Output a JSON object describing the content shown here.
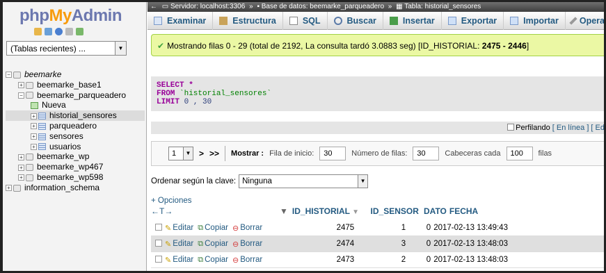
{
  "logo": {
    "php": "php",
    "my": "My",
    "admin": "Admin"
  },
  "recent": {
    "label": "(Tablas recientes) ..."
  },
  "tree": {
    "root": "beemarke",
    "items": [
      {
        "label": "beemarke_base1"
      },
      {
        "label": "beemarke_parqueadero"
      },
      {
        "label": "Nueva"
      },
      {
        "label": "historial_sensores"
      },
      {
        "label": "parqueadero"
      },
      {
        "label": "sensores"
      },
      {
        "label": "usuarios"
      },
      {
        "label": "beemarke_wp"
      },
      {
        "label": "beemarke_wp467"
      },
      {
        "label": "beemarke_wp598"
      },
      {
        "label": "information_schema"
      }
    ]
  },
  "breadcrumb": {
    "server": "Servidor: localhost:3306",
    "database": "Base de datos: beemarke_parqueadero",
    "table": "Tabla: historial_sensores",
    "sep": "»"
  },
  "tabs": [
    "Examinar",
    "Estructura",
    "SQL",
    "Buscar",
    "Insertar",
    "Exportar",
    "Importar",
    "Operac"
  ],
  "message": {
    "text": "Mostrando filas 0 - 29 (total de 2192, La consulta tardó 3.0883 seg) [ID_HISTORIAL: ",
    "range": "2475 - 2446",
    "end": "]"
  },
  "sql": {
    "select": "SELECT",
    "star": " *",
    "from": "FROM",
    "table": " `historial_sensores`",
    "limit": "LIMIT",
    "limit_vals": " 0 , 30"
  },
  "profile": {
    "label": "Perfilando",
    "inline": "[ En línea ] [ Ed"
  },
  "nav": {
    "page": "1",
    "next": ">",
    "last": ">>",
    "show": "Mostrar :",
    "start_label": "Fila de inicio:",
    "start_val": "30",
    "rows_label": "Número de filas:",
    "rows_val": "30",
    "headers_label": "Cabeceras cada",
    "headers_val": "100",
    "rows_suffix": "filas"
  },
  "order": {
    "label": "Ordenar según la clave:",
    "value": "Ninguna"
  },
  "options": {
    "label": "+ Opciones",
    "arrows": "←T→"
  },
  "columns": {
    "sort": "▼",
    "id": "ID_HISTORIAL",
    "id_sort": "▼",
    "sensor": "ID_SENSOR",
    "dato": "DATO",
    "fecha": "FECHA"
  },
  "actions": {
    "edit": "Editar",
    "copy": "Copiar",
    "delete": "Borrar"
  },
  "rows": [
    {
      "id": "2475",
      "sensor": "1",
      "dato": "0",
      "fecha": "2017-02-13 13:49:43"
    },
    {
      "id": "2474",
      "sensor": "3",
      "dato": "0",
      "fecha": "2017-02-13 13:48:03"
    },
    {
      "id": "2473",
      "sensor": "2",
      "dato": "0",
      "fecha": "2017-02-13 13:48:03"
    }
  ]
}
